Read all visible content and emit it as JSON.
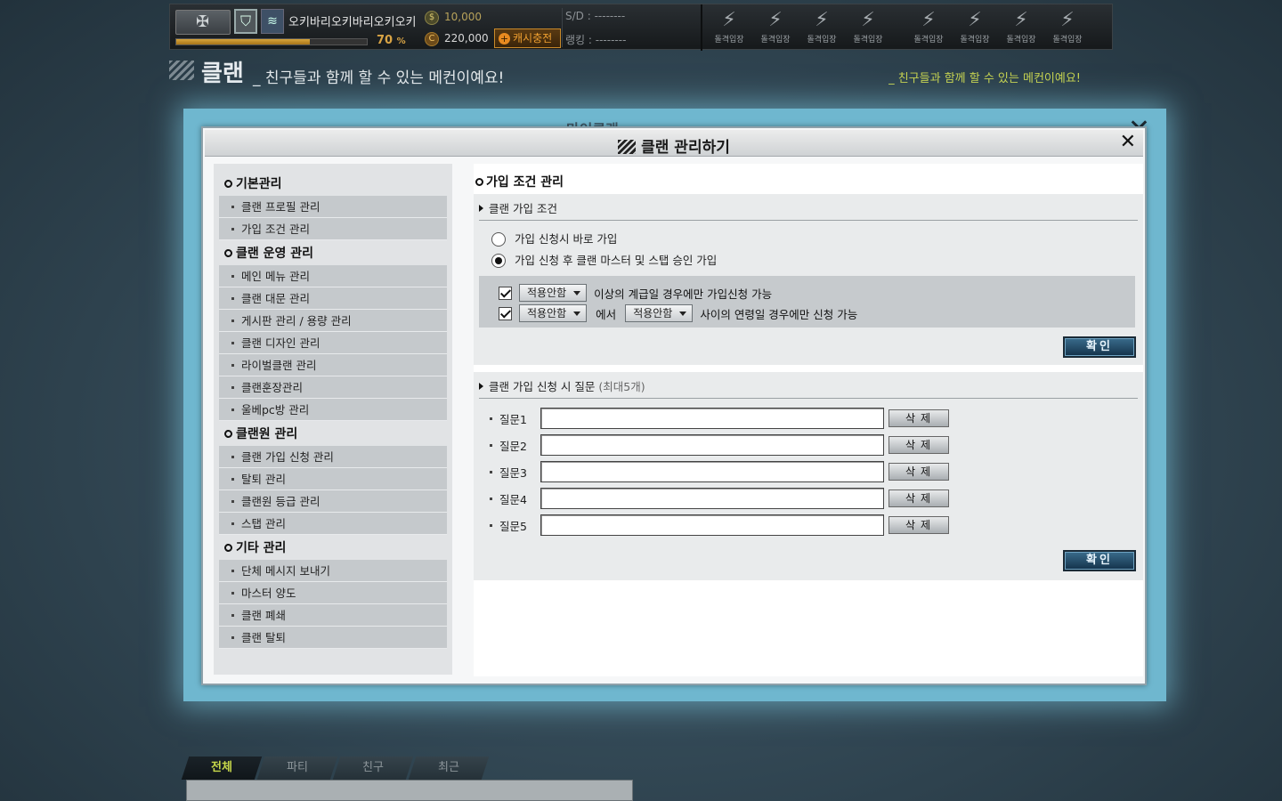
{
  "topbar": {
    "player_name": "오키바리오키바리오키오키",
    "exp_percent": 70,
    "exp_label": "70",
    "exp_unit": "%",
    "gold": "10,000",
    "cash": "220,000",
    "charge_button": "캐시충전",
    "sd_label": "S/D : --------",
    "rank_label": "랭킹 : --------",
    "quick_slots": [
      "돌격입장",
      "돌격입장",
      "돌격입장",
      "돌격입장",
      "돌격입장",
      "돌격입장",
      "돌격입장",
      "돌격입장"
    ]
  },
  "page": {
    "title": "클랜",
    "subtitle": "_ 친구들과 함께 할 수 있는 메컨이예요!",
    "subtitle_right": "_ 친구들과 함께 할 수 있는 메컨이예요!",
    "behind_title": "마이클랜"
  },
  "dialog": {
    "title": "클랜 관리하기",
    "close_label": "✕",
    "sidebar": [
      {
        "group": "기본관리",
        "items": [
          "클랜 프로필 관리",
          "가입 조건 관리"
        ]
      },
      {
        "group": "클랜 운영 관리",
        "items": [
          "메인 메뉴 관리",
          "클랜 대문 관리",
          "게시판 관리 / 용량 관리",
          "클랜 디자인 관리",
          "라이벌클랜 관리",
          "클랜훈장관리",
          "울베pc방 관리"
        ]
      },
      {
        "group": "클랜원 관리",
        "items": [
          "클랜 가입 신청 관리",
          "탈퇴 관리",
          "클랜원 등급 관리",
          "스탭 관리"
        ]
      },
      {
        "group": "기타 관리",
        "items": [
          "단체 메시지 보내기",
          "마스터 양도",
          "클랜 폐쇄",
          "클랜 탈퇴"
        ]
      }
    ],
    "content": {
      "heading": "가입 조건 관리",
      "join_section": {
        "title": "클랜 가입 조건",
        "options": [
          {
            "label": "가입 신청시 바로 가입",
            "selected": false
          },
          {
            "label": "가입 신청 후 클랜 마스터 및 스탭 승인 가입",
            "selected": true
          }
        ],
        "conditions": {
          "rank_select": "적용안함",
          "rank_text": "이상의 계급일 경우에만 가입신청 가능",
          "age_from_select": "적용안함",
          "age_mid_text": "에서",
          "age_to_select": "적용안함",
          "age_text": "사이의 연령일 경우에만 신청 가능"
        },
        "confirm": "확인"
      },
      "question_section": {
        "title": "클랜 가입 신청 시 질문",
        "title_sub": "(최대5개)",
        "questions": [
          {
            "label": "질문1",
            "value": ""
          },
          {
            "label": "질문2",
            "value": ""
          },
          {
            "label": "질문3",
            "value": ""
          },
          {
            "label": "질문4",
            "value": ""
          },
          {
            "label": "질문5",
            "value": ""
          }
        ],
        "delete_label": "삭제",
        "confirm": "확인"
      }
    }
  },
  "chat": {
    "tabs": [
      "전체",
      "파티",
      "친구",
      "최근"
    ],
    "active_tab": "전체"
  }
}
